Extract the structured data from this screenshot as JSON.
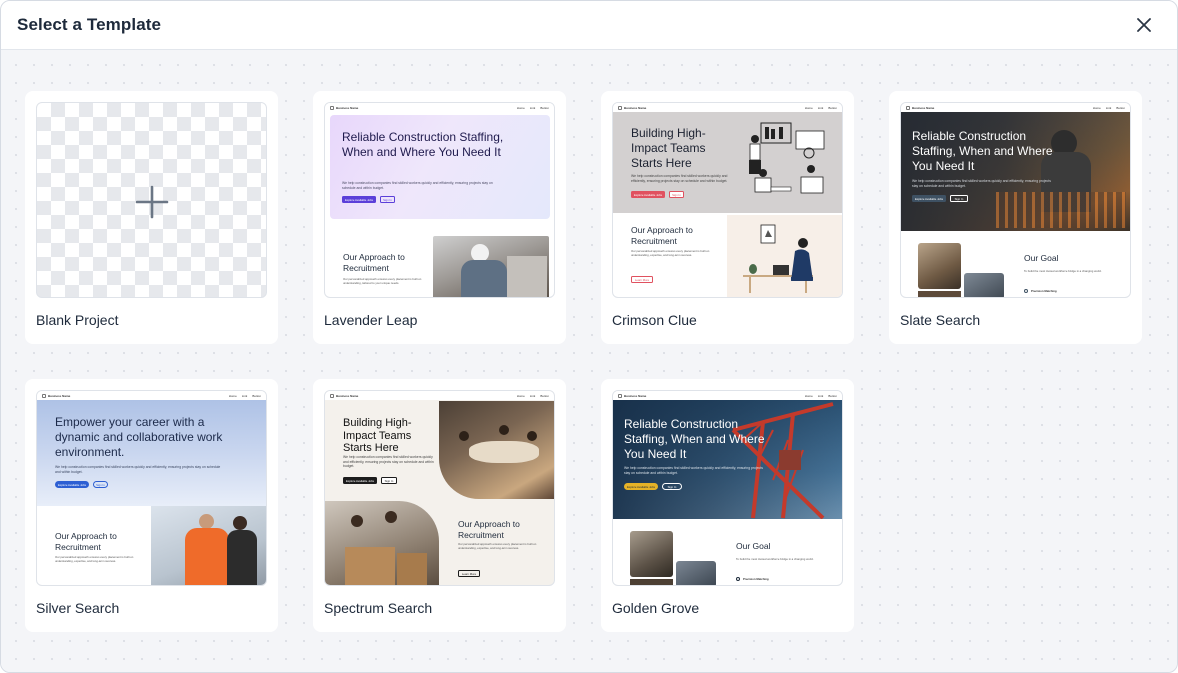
{
  "dialog": {
    "title": "Select a Template",
    "close_icon": "close-icon"
  },
  "templates": [
    {
      "name": "Blank Project",
      "icon": "plus-icon"
    },
    {
      "name": "Lavender Leap",
      "nav_brand": "Business Name",
      "nav_links": [
        "Home",
        "Link",
        "Button"
      ],
      "hero_title": "Reliable Construction Staffing, When and Where You Need It",
      "hero_sub": "We help construction companies find skilled workers quickly and efficiently, ensuring projects stay on schedule and within budget.",
      "primary_btn": "Explore Available Jobs",
      "secondary_btn": "Sign In",
      "section_title": "Our Approach to Recruitment",
      "section_body": "Our personalized approach ensures every placement is built on understanding, tailored to your unique needs.",
      "accent": "#5b3fd9"
    },
    {
      "name": "Crimson Clue",
      "nav_brand": "Business Name",
      "nav_links": [
        "Home",
        "Link",
        "Button"
      ],
      "hero_title": "Building High-Impact Teams Starts Here",
      "hero_sub": "We help construction companies find skilled workers quickly and efficiently, ensuring projects stay on schedule and within budget.",
      "primary_btn": "Explore Available Jobs",
      "secondary_btn": "Sign In",
      "section_title": "Our Approach to Recruitment",
      "section_body": "Our personalized approach ensures every placement is built on understanding, expertise, and long-term success.",
      "section_btn": "Learn More",
      "accent": "#e0515f"
    },
    {
      "name": "Slate Search",
      "nav_brand": "Business Name",
      "nav_links": [
        "Home",
        "Link",
        "Button"
      ],
      "hero_title": "Reliable Construction Staffing, When and Where You Need It",
      "hero_sub": "We help construction companies find skilled workers quickly and efficiently, ensuring projects stay on schedule and within budget.",
      "primary_btn": "Explore Available Jobs",
      "secondary_btn": "Sign In",
      "section_title": "Our Goal",
      "section_body": "To build the most trusted workforce bridge in a changing world.",
      "feature_title": "Precision Matching",
      "accent": "#3e5163"
    },
    {
      "name": "Silver Search",
      "nav_brand": "Business Name",
      "nav_links": [
        "Home",
        "Link",
        "Button"
      ],
      "hero_title": "Empower your career with a dynamic and collaborative work environment.",
      "hero_sub": "We help construction companies find skilled workers quickly and efficiently, ensuring projects stay on schedule and within budget.",
      "primary_btn": "Explore Available Jobs",
      "secondary_btn": "Sign In",
      "section_title": "Our Approach to Recruitment",
      "section_body": "Our personalized approach ensures every placement is built on understanding, expertise, and long-term success.",
      "accent": "#2d5fd3"
    },
    {
      "name": "Spectrum Search",
      "nav_brand": "Business Name",
      "nav_links": [
        "Home",
        "Link",
        "Button"
      ],
      "hero_title": "Building High-Impact Teams Starts Here",
      "hero_sub": "We help construction companies find skilled workers quickly and efficiently, ensuring projects stay on schedule and within budget.",
      "primary_btn": "Explore Available Jobs",
      "secondary_btn": "Sign In",
      "section_title": "Our Approach to Recruitment",
      "section_body": "Our personalized approach ensures every placement is built on understanding, expertise, and long-term success.",
      "section_btn": "Learn More",
      "accent": "#1c1c1c"
    },
    {
      "name": "Golden Grove",
      "nav_brand": "Business Name",
      "nav_links": [
        "Home",
        "Link",
        "Button"
      ],
      "hero_title": "Reliable Construction Staffing, When and Where You Need It",
      "hero_sub": "We help construction companies find skilled workers quickly and efficiently, ensuring projects stay on schedule and within budget.",
      "primary_btn": "Explore Available Jobs",
      "secondary_btn": "Sign In",
      "section_title": "Our Goal",
      "section_body": "To build the most trusted workforce bridge in a changing world.",
      "feature_title": "Precision Matching",
      "accent": "#e5b227"
    }
  ]
}
